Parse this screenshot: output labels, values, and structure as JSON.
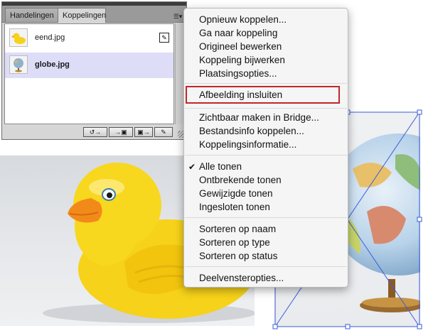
{
  "panel": {
    "tabs": [
      {
        "label": "Handelingen"
      },
      {
        "label": "Koppelingen"
      }
    ],
    "menu_button_icon": "panel-menu-icon",
    "links": [
      {
        "name": "eend.jpg",
        "thumbnail": "duck-thumbnail",
        "status_icon": "link-status-icon"
      },
      {
        "name": "globe.jpg",
        "thumbnail": "globe-thumbnail",
        "selected": true
      }
    ],
    "bottom_buttons": [
      {
        "icon": "relink-icon"
      },
      {
        "icon": "go-to-link-icon"
      },
      {
        "icon": "update-link-icon"
      },
      {
        "icon": "edit-original-icon"
      }
    ]
  },
  "menu": {
    "groups": [
      [
        "Opnieuw koppelen...",
        "Ga naar koppeling",
        "Origineel bewerken",
        "Koppeling bijwerken",
        "Plaatsingsopties..."
      ],
      [
        "Afbeelding insluiten"
      ],
      [
        "Zichtbaar maken in Bridge...",
        "Bestandsinfo koppelen...",
        "Koppelingsinformatie..."
      ],
      [
        "Alle tonen",
        "Ontbrekende tonen",
        "Gewijzigde tonen",
        "Ingesloten tonen"
      ],
      [
        "Sorteren op naam",
        "Sorteren op type",
        "Sorteren op status"
      ],
      [
        "Deelvensteropties..."
      ]
    ],
    "checked_item": "Alle tonen",
    "highlighted_item": "Afbeelding insluiten",
    "highlight_color": "#c0272d"
  },
  "canvas": {
    "images": [
      "duck-image",
      "globe-image"
    ],
    "selection_color": "#3a5bd9"
  }
}
